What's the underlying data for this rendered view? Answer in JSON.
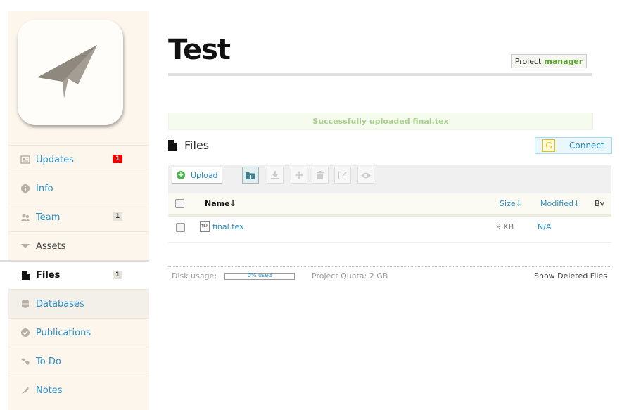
{
  "sidebar": {
    "items": [
      {
        "label": "Updates",
        "icon": "updates-icon",
        "count": "1",
        "count_style": "red"
      },
      {
        "label": "Info",
        "icon": "info-icon"
      },
      {
        "label": "Team",
        "icon": "team-icon",
        "count": "1"
      },
      {
        "label": "Assets",
        "icon": "chevron-down-icon"
      },
      {
        "label": "Files",
        "icon": "file-icon",
        "count": "1",
        "active": true
      },
      {
        "label": "Databases",
        "icon": "database-icon"
      },
      {
        "label": "Publications",
        "icon": "check-circle-icon"
      },
      {
        "label": "To Do",
        "icon": "todo-icon"
      },
      {
        "label": "Notes",
        "icon": "feather-icon"
      }
    ]
  },
  "header": {
    "title": "Test",
    "role_prefix": "Project",
    "role": "manager"
  },
  "notice": "Successfully uploaded final.tex",
  "files": {
    "heading": "Files",
    "connect_label": "Connect",
    "connect_icon_letter": "G",
    "upload_label": "Upload",
    "columns": {
      "name": "Name↓",
      "size": "Size↓",
      "modified": "Modified↓",
      "by": "By"
    },
    "rows": [
      {
        "name": "final.tex",
        "icon_text": "TEX",
        "size": "9 KB",
        "modified": "N/A"
      }
    ]
  },
  "footer": {
    "disk_label": "Disk usage:",
    "disk_used": "0% used",
    "quota": "Project Quota: 2 GB",
    "deleted": "Show Deleted Files"
  },
  "colors": {
    "accent": "#2a8fc7",
    "sidebar_bg": "#fdf6ec",
    "badge_red": "#ee0000",
    "success": "#a9cf8e"
  }
}
